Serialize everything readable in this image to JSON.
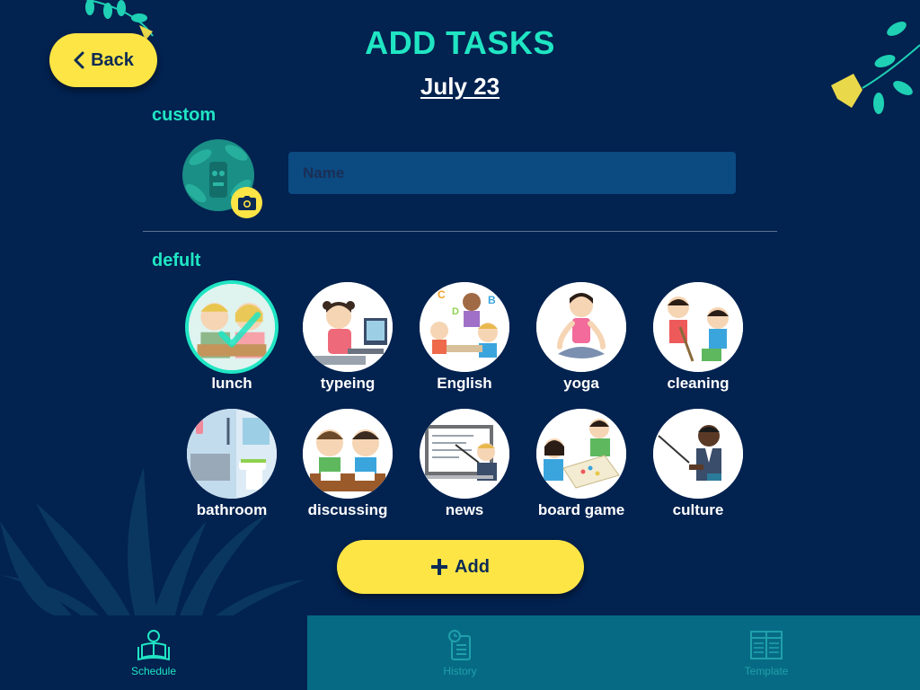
{
  "header": {
    "back_label": "Back",
    "title": "ADD TASKS",
    "date": "July 23"
  },
  "custom": {
    "section_label": "custom",
    "name_placeholder": "Name",
    "name_value": ""
  },
  "default": {
    "section_label": "defult",
    "tasks": [
      {
        "label": "lunch",
        "selected": true
      },
      {
        "label": "typeing",
        "selected": false
      },
      {
        "label": "English",
        "selected": false
      },
      {
        "label": "yoga",
        "selected": false
      },
      {
        "label": "cleaning",
        "selected": false
      },
      {
        "label": "bathroom",
        "selected": false
      },
      {
        "label": "discussing",
        "selected": false
      },
      {
        "label": "news",
        "selected": false
      },
      {
        "label": "board game",
        "selected": false
      },
      {
        "label": "culture",
        "selected": false
      }
    ]
  },
  "add_button": {
    "label": "Add"
  },
  "tabbar": {
    "active": "Schedule",
    "tabs": [
      {
        "label": "Schedule",
        "icon": "reader-icon"
      },
      {
        "label": "History",
        "icon": "history-icon"
      },
      {
        "label": "Template",
        "icon": "template-icon"
      }
    ]
  },
  "colors": {
    "background": "#022250",
    "accent": "#20e5c3",
    "button": "#fde545",
    "input": "#0c4a82",
    "tab_inactive": "#066a85"
  }
}
